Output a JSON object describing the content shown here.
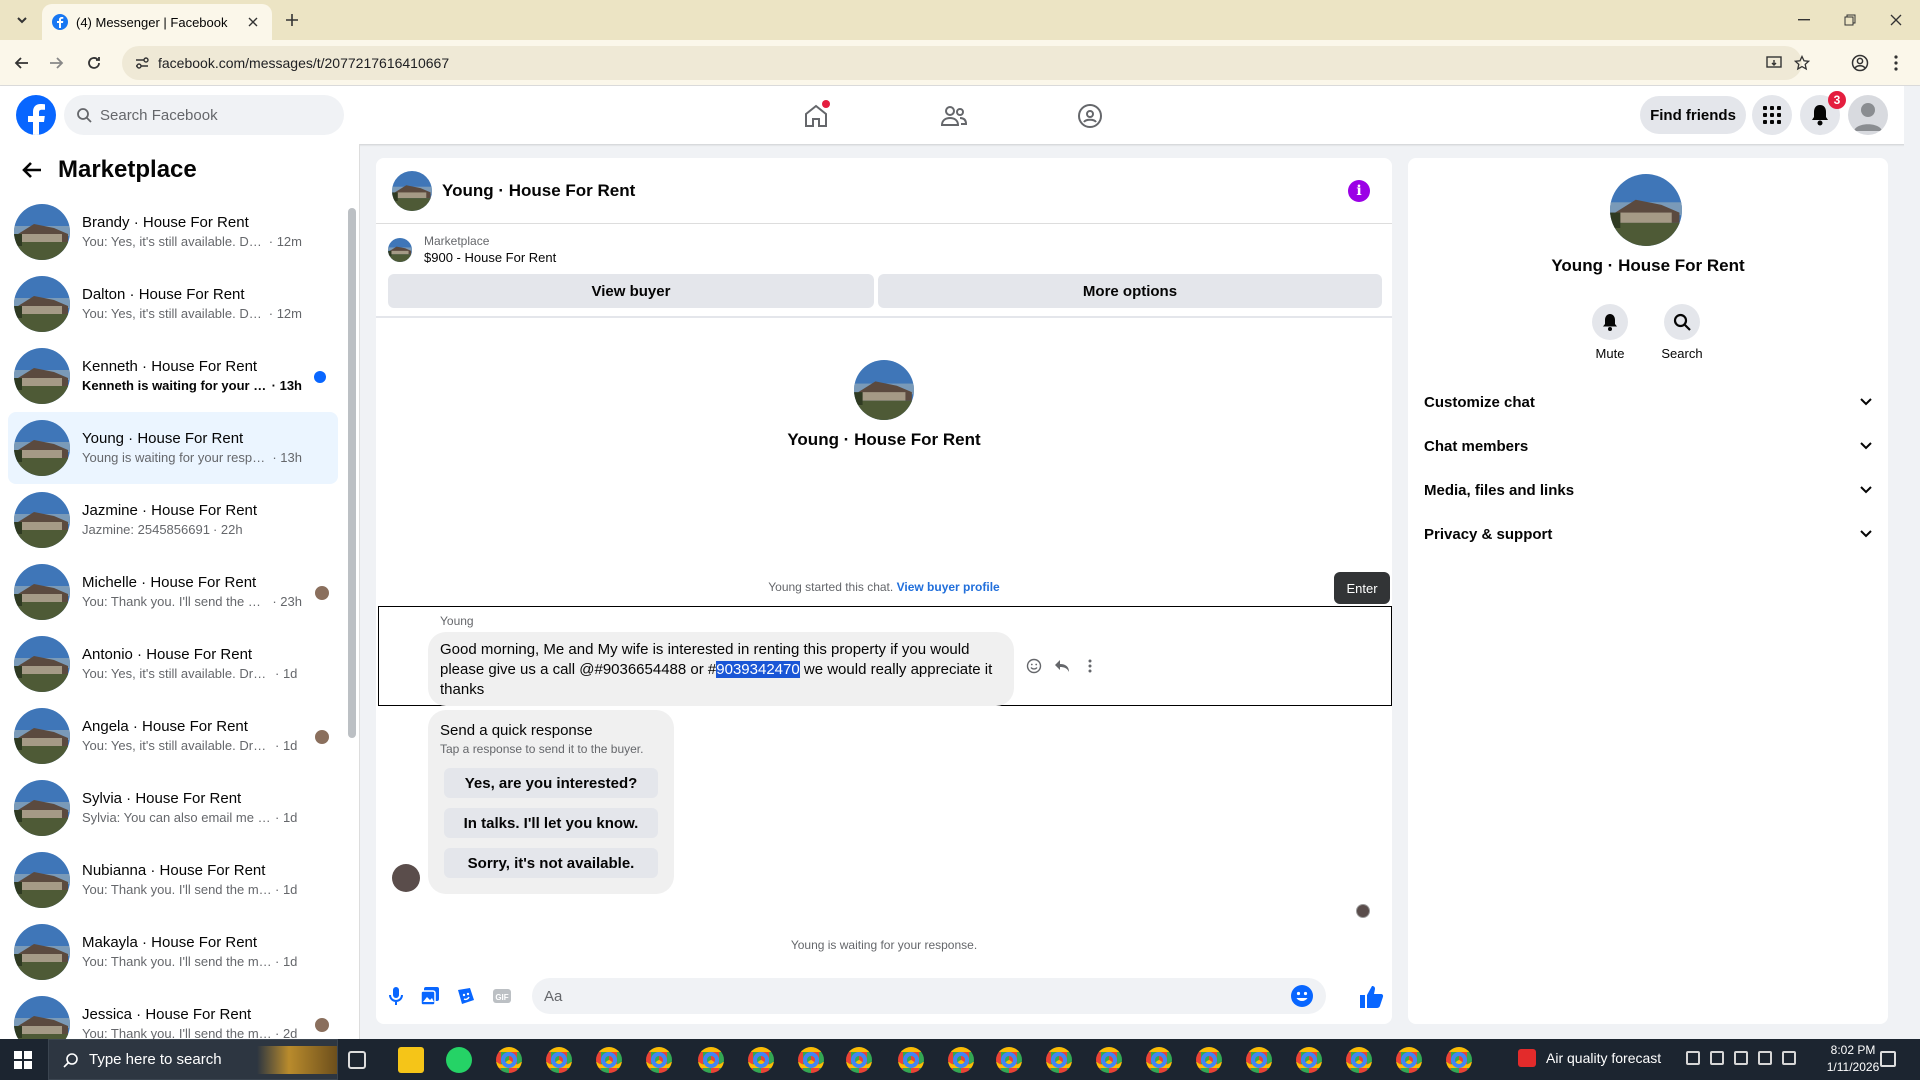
{
  "browser": {
    "tab_title": "(4) Messenger | Facebook",
    "url": "facebook.com/messages/t/2077217616410667"
  },
  "header": {
    "search_placeholder": "Search Facebook",
    "find_friends": "Find friends",
    "notification_count": "3"
  },
  "sidebar": {
    "title": "Marketplace",
    "conversations": [
      {
        "name": "Brandy · House For Rent",
        "preview": "You: Yes, it's still available. Drop ...",
        "time": "· 12m"
      },
      {
        "name": "Dalton · House For Rent",
        "preview": "You: Yes, it's still available. Drop ...",
        "time": "· 12m"
      },
      {
        "name": "Kenneth · House For Rent",
        "preview": "Kenneth is waiting for your res...",
        "time": "· 13h"
      },
      {
        "name": "Young · House For Rent",
        "preview": "Young is waiting for your response.",
        "time": "· 13h"
      },
      {
        "name": "Jazmine · House For Rent",
        "preview": "Jazmine: 2545856691",
        "time": "· 22h"
      },
      {
        "name": "Michelle · House For Rent",
        "preview": "You: Thank you. I'll send the me...",
        "time": "· 23h"
      },
      {
        "name": "Antonio · House For Rent",
        "preview": "You: Yes, it's still available. Drop me...",
        "time": "· 1d"
      },
      {
        "name": "Angela · House For Rent",
        "preview": "You: Yes, it's still available. Drop ...",
        "time": "· 1d"
      },
      {
        "name": "Sylvia · House For Rent",
        "preview": "Sylvia: You can also email me at syl...",
        "time": "· 1d"
      },
      {
        "name": "Nubianna · House For Rent",
        "preview": "You: Thank you. I'll send the messa...",
        "time": "· 1d"
      },
      {
        "name": "Makayla · House For Rent",
        "preview": "You: Thank you. I'll send the messa...",
        "time": "· 1d"
      },
      {
        "name": "Jessica · House For Rent",
        "preview": "You: Thank you. I'll send the mes...",
        "time": "· 2d"
      }
    ]
  },
  "chat": {
    "title": "Young · House For Rent",
    "marketplace_label": "Marketplace",
    "listing": "$900 - House For Rent",
    "view_buyer": "View buyer",
    "more_options": "More options",
    "intro_name": "Young · House For Rent",
    "started_text": "Young started this chat.",
    "view_buyer_profile": "View buyer profile",
    "enter_tooltip": "Enter",
    "sender": "Young",
    "message_part1": "Good morning, Me and My wife is interested in renting this property if you would please give us a call @#9036654488 or #",
    "message_highlight": "9039342470",
    "message_part2": " we would really appreciate it thanks",
    "quick_title": "Send a quick response",
    "quick_sub": "Tap a response to send it to the buyer.",
    "quick_responses": [
      "Yes, are you interested?",
      "In talks. I'll let you know.",
      "Sorry, it's not available."
    ],
    "waiting": "Young is waiting for your response.",
    "composer_placeholder": "Aa"
  },
  "right_panel": {
    "name": "Young · House For Rent",
    "mute": "Mute",
    "search": "Search",
    "sections": [
      "Customize chat",
      "Chat members",
      "Media, files and links",
      "Privacy & support"
    ]
  },
  "taskbar": {
    "search_placeholder": "Type here to search",
    "weather": "Air quality forecast",
    "time": "8:02 PM",
    "date": "1/11/2026"
  },
  "colors": {
    "fb_blue": "#0866ff",
    "selected_row": "#ebf5ff",
    "info_purple": "#9b00e6",
    "highlight": "#1a56d6"
  }
}
